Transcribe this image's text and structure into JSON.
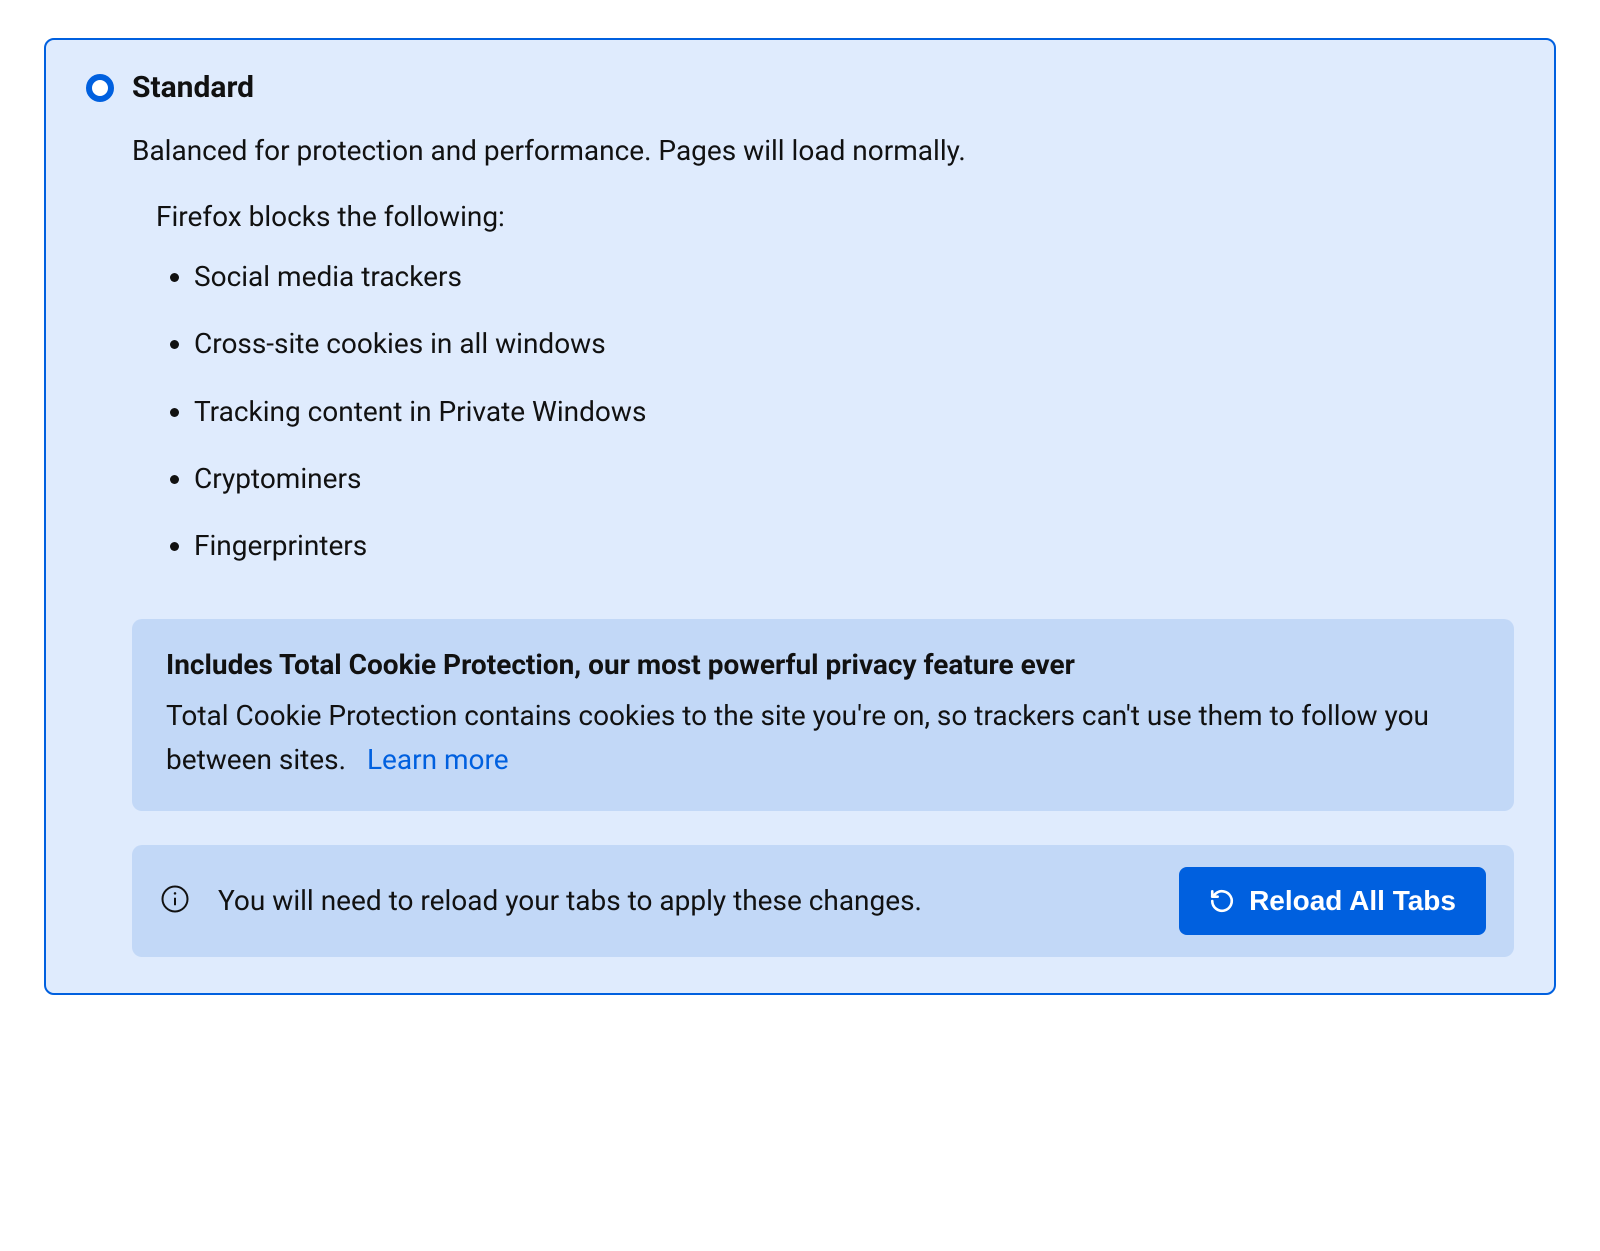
{
  "protection": {
    "option_label": "Standard",
    "subtitle": "Balanced for protection and performance. Pages will load normally.",
    "blocks_heading": "Firefox blocks the following:",
    "blocks": [
      "Social media trackers",
      "Cross-site cookies in all windows",
      "Tracking content in Private Windows",
      "Cryptominers",
      "Fingerprinters"
    ],
    "tcp": {
      "title": "Includes Total Cookie Protection, our most powerful privacy feature ever",
      "body": "Total Cookie Protection contains cookies to the site you're on, so trackers can't use them to follow you between sites.",
      "learn_more": "Learn more"
    },
    "reload": {
      "message": "You will need to reload your tabs to apply these changes.",
      "button": "Reload All Tabs"
    }
  },
  "colors": {
    "accent": "#0060df",
    "panel_bg": "#dfebfd",
    "callout_bg": "#c2d8f7"
  }
}
